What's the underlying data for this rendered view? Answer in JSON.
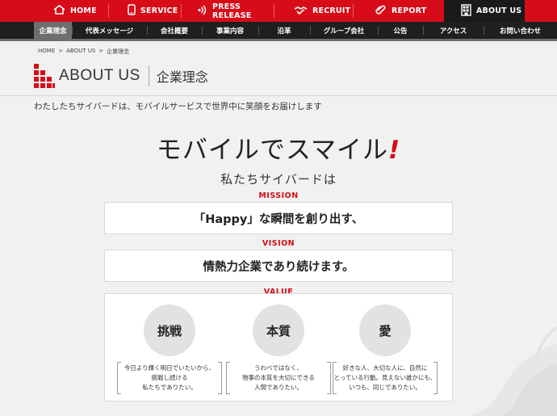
{
  "top_nav": [
    {
      "label": "HOME",
      "icon": "home-icon"
    },
    {
      "label": "SERVICE",
      "icon": "phone-icon"
    },
    {
      "label": "PRESS RELEASE",
      "icon": "signal-icon"
    },
    {
      "label": "RECRUIT",
      "icon": "handshake-icon"
    },
    {
      "label": "REPORT",
      "icon": "clip-icon"
    },
    {
      "label": "ABOUT US",
      "icon": "building-icon",
      "active": true
    }
  ],
  "sub_nav": [
    {
      "label": "企業理念",
      "active": true
    },
    {
      "label": "代表メッセージ"
    },
    {
      "label": "会社概要"
    },
    {
      "label": "事業内容"
    },
    {
      "label": "沿革"
    },
    {
      "label": "グループ会社"
    },
    {
      "label": "公告"
    },
    {
      "label": "アクセス"
    },
    {
      "label": "お問い合わせ"
    }
  ],
  "breadcrumb": [
    "HOME",
    ">",
    "ABOUT US",
    ">",
    "企業理念"
  ],
  "page_title": {
    "en": "ABOUT US",
    "jp": "企業理念"
  },
  "lead": "わたしたちサイバードは、モバイルサービスで世界中に笑顔をお届けします",
  "slogan": {
    "text": "モバイルでスマイル",
    "mark": "!"
  },
  "sub_slogan": "私たちサイバードは",
  "mission": {
    "label": "MISSION",
    "text": "「Happy」な瞬間を創り出す、"
  },
  "vision": {
    "label": "VISION",
    "text": "情熱力企業であり続けます。"
  },
  "value": {
    "label": "VALUE",
    "items": [
      {
        "title": "挑戦",
        "lines": [
          "今日より輝く明日でいたいから、",
          "挑戦し続ける",
          "私たちでありたい。"
        ]
      },
      {
        "title": "本質",
        "lines": [
          "うわべではなく、",
          "物事の本質を大切にできる",
          "人間でありたい。"
        ]
      },
      {
        "title": "愛",
        "lines": [
          "好きな人、大切な人に、自然に",
          "とっている行動。見えない誰かにも、",
          "いつも、同じでありたい。"
        ]
      }
    ]
  },
  "colors": {
    "accent": "#d70c18",
    "dark": "#1f1f1f",
    "bg": "#f1f1f1"
  }
}
